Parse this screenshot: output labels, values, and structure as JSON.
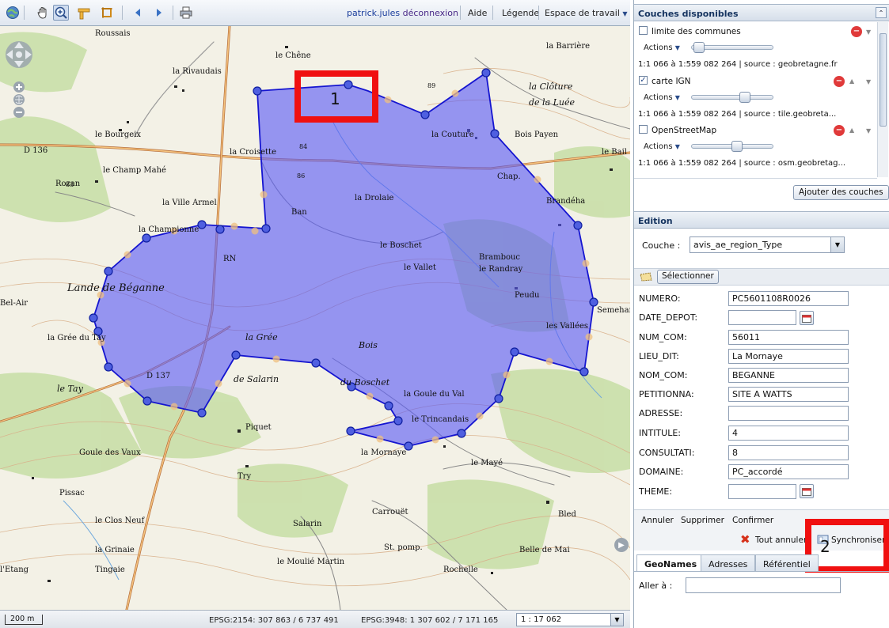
{
  "toolbar": {
    "user": "patrick.jules",
    "logout": "déconnexion",
    "help": "Aide",
    "legend": "Légende",
    "workspace": "Espace de travail"
  },
  "map": {
    "place_labels": [
      "Roussais",
      "le Chêne",
      "la Barrière",
      "la Rivaudais",
      "la Clôture",
      "de la Luée",
      "le Bourgeix",
      "la Couture",
      "Bois Payen",
      "le Bail",
      "la Croisette",
      "le Champ Mahé",
      "Rozan",
      "la Ville Armel",
      "la Drolaie",
      "Brandéha",
      "Ban",
      "la Championne",
      "le Boschet",
      "Brambouc",
      "le Vallet",
      "le Randray",
      "Lande de Béganne",
      "Peudu",
      "Bel-Air",
      "la Grée du Tay",
      "la Grée",
      "Bois",
      "les Vallées",
      "le Tay",
      "de Salarin",
      "du Boschet",
      "la Goule du Val",
      "Piquet",
      "le Trincandais",
      "Goule des Vaux",
      "la Mornaye",
      "le Mayé",
      "Try",
      "Pissac",
      "Carrouët",
      "Bled",
      "Salarin",
      "le Clos Neuf",
      "la Grinaie",
      "St. pomp.",
      "Belle de Mai",
      "l'Etang",
      "Tingaie",
      "le Moulié Martin",
      "Rochelle",
      "D 136",
      "D 137",
      "Chap.",
      "RN",
      "Semehan",
      "89",
      "84",
      "86",
      "83"
    ],
    "annotations": [
      "1",
      "2"
    ]
  },
  "status": {
    "scale_bar": "200 m",
    "coord_l93": "EPSG:2154: 307 863 / 6 737 491",
    "coord_wgs": "EPSG:3948: 1 307 602 / 7 171 165",
    "scale": "1 : 17 062"
  },
  "layers_panel": {
    "title": "Couches disponibles",
    "layers": [
      {
        "name": "limite des communes",
        "checked": false,
        "actions": "Actions",
        "opacity": 0.08,
        "source": "1:1 066 à 1:559 082 264 | source : geobretagne.fr"
      },
      {
        "name": "carte IGN",
        "checked": true,
        "actions": "Actions",
        "opacity": 0.6,
        "source": "1:1 066 à 1:559 082 264 | source : tile.geobreta..."
      },
      {
        "name": "OpenStreetMap",
        "checked": false,
        "actions": "Actions",
        "opacity": 0.5,
        "source": "1:1 066 à 1:559 082 264 | source : osm.geobretag..."
      }
    ],
    "add_button": "Ajouter des couches"
  },
  "edition": {
    "title": "Edition",
    "layer_label": "Couche :",
    "layer_value": "avis_ae_region_Type",
    "select_button": "Sélectionner",
    "fields": [
      {
        "label": "NUMERO:",
        "value": "PC5601108R0026"
      },
      {
        "label": "DATE_DEPOT:",
        "value": ""
      },
      {
        "label": "NUM_COM:",
        "value": "56011"
      },
      {
        "label": "LIEU_DIT:",
        "value": "La Mornaye"
      },
      {
        "label": "NOM_COM:",
        "value": "BEGANNE"
      },
      {
        "label": "PETITIONNA:",
        "value": "SITE A WATTS"
      },
      {
        "label": "ADRESSE:",
        "value": ""
      },
      {
        "label": "INTITULE:",
        "value": "4"
      },
      {
        "label": "CONSULTATI:",
        "value": "8"
      },
      {
        "label": "DOMAINE:",
        "value": "PC_accordé"
      },
      {
        "label": "THEME:",
        "value": ""
      }
    ],
    "cancel": "Annuler",
    "delete": "Supprimer",
    "confirm": "Confirmer",
    "cancel_all": "Tout annuler",
    "sync": "Synchroniser"
  },
  "search": {
    "tabs": [
      "GeoNames",
      "Adresses",
      "Référentiel"
    ],
    "goto_label": "Aller à :",
    "goto_value": ""
  },
  "colors": {
    "polygon_fill": "#5a5af5",
    "polygon_stroke": "#1515d0",
    "annotation": "#f01010",
    "header_text": "#15335f"
  }
}
